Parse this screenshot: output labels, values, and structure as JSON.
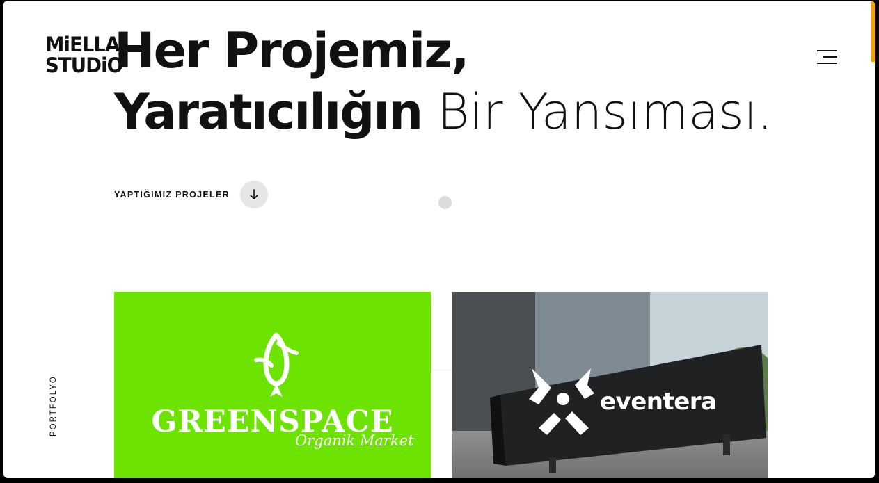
{
  "brand": {
    "logo_line1": "MiELLA",
    "logo_line2": "STUDiO"
  },
  "hero": {
    "line1": "Her Projemiz,",
    "line2_bold": "Yaratıcılığın",
    "line2_light": "Bir Yansıması."
  },
  "cta": {
    "label": "YAPTIĞIMIZ PROJELER",
    "icon": "arrow-down-icon"
  },
  "menu": {
    "icon": "hamburger-menu-icon"
  },
  "side_label": "PORTFOLYO",
  "projects": [
    {
      "name": "GREENSPACE",
      "tagline": "Organik Market",
      "bg": "#6ce300"
    },
    {
      "name": "eventera",
      "bg": "#9fb0b8"
    }
  ],
  "colors": {
    "accent": "#f5a100",
    "text": "#111111"
  }
}
